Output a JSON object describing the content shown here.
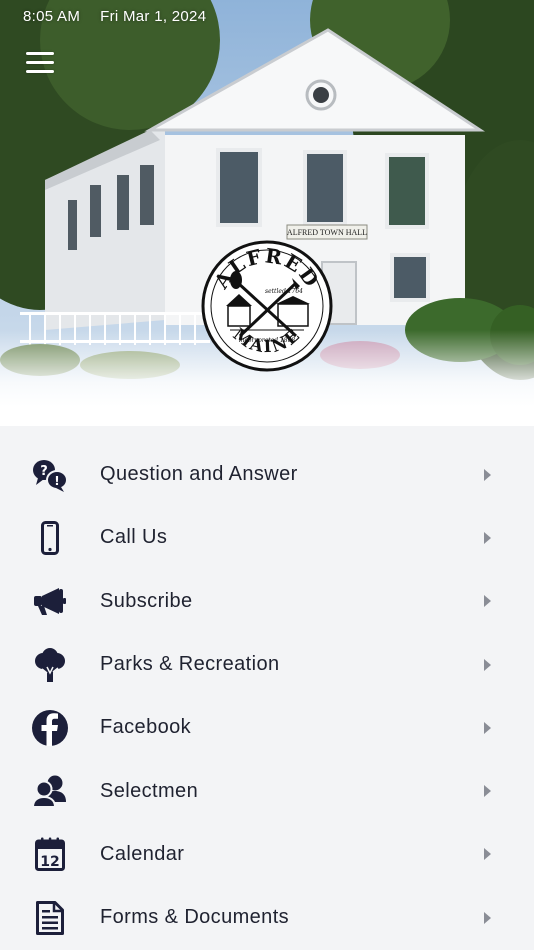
{
  "status_bar": {
    "time": "8:05 AM",
    "date": "Fri Mar 1, 2024"
  },
  "header": {
    "menu_icon": "hamburger-menu-icon"
  },
  "hero": {
    "building_sign": "ALFRED TOWN HALL",
    "seal": {
      "name": "ALFRED",
      "settled": "settled 1764",
      "incorporated": "incorporated 1808",
      "state": "MAINE"
    }
  },
  "menu": {
    "items": [
      {
        "label": "Question and Answer",
        "icon": "question-answer-icon"
      },
      {
        "label": "Call Us",
        "icon": "phone-icon"
      },
      {
        "label": "Subscribe",
        "icon": "megaphone-icon"
      },
      {
        "label": "Parks & Recreation",
        "icon": "tree-icon"
      },
      {
        "label": "Facebook",
        "icon": "facebook-icon"
      },
      {
        "label": "Selectmen",
        "icon": "people-icon"
      },
      {
        "label": "Calendar",
        "icon": "calendar-icon"
      },
      {
        "label": "Forms & Documents",
        "icon": "document-icon"
      }
    ]
  },
  "colors": {
    "icon": "#1c1f3a",
    "label": "#1f2230",
    "chevron": "#8a8d96",
    "list_background": "#f3f4f6"
  }
}
